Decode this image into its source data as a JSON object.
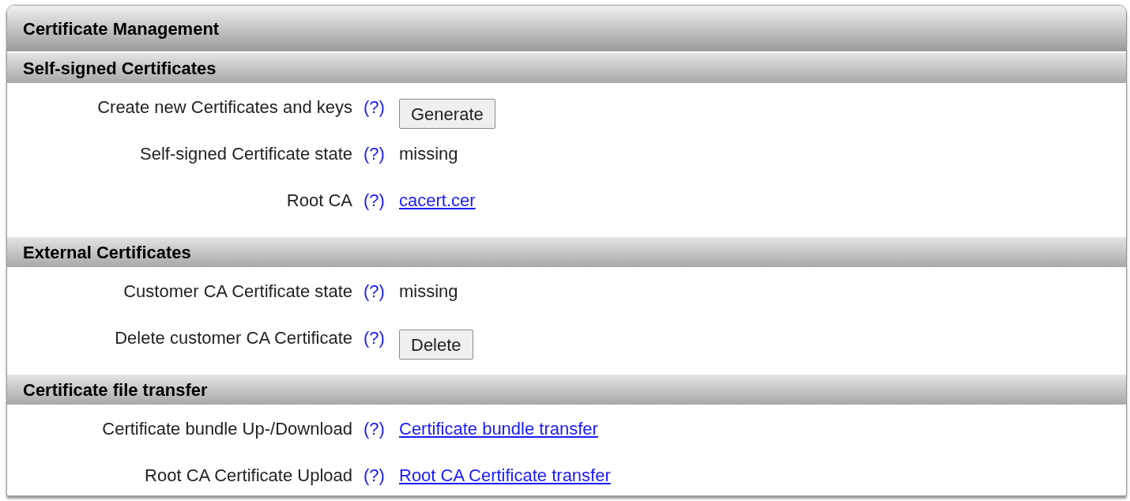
{
  "panel": {
    "title": "Certificate Management"
  },
  "sections": [
    {
      "title": "Self-signed Certificates",
      "rows": [
        {
          "label": "Create new Certificates and keys",
          "help": "(?)",
          "kind": "button",
          "value": "Generate"
        },
        {
          "label": "Self-signed Certificate state",
          "help": "(?)",
          "kind": "text",
          "value": "missing"
        },
        {
          "label": "Root CA",
          "help": "(?)",
          "kind": "link",
          "value": "cacert.cer"
        }
      ]
    },
    {
      "title": "External Certificates",
      "rows": [
        {
          "label": "Customer CA Certificate state",
          "help": "(?)",
          "kind": "text",
          "value": "missing"
        },
        {
          "label": "Delete customer CA Certificate",
          "help": "(?)",
          "kind": "button",
          "value": "Delete"
        }
      ]
    },
    {
      "title": "Certificate file transfer",
      "rows": [
        {
          "label": "Certificate bundle Up-/Download",
          "help": "(?)",
          "kind": "link",
          "value": "Certificate bundle transfer"
        },
        {
          "label": "Root CA Certificate Upload",
          "help": "(?)",
          "kind": "link",
          "value": "Root CA Certificate transfer"
        }
      ]
    }
  ]
}
